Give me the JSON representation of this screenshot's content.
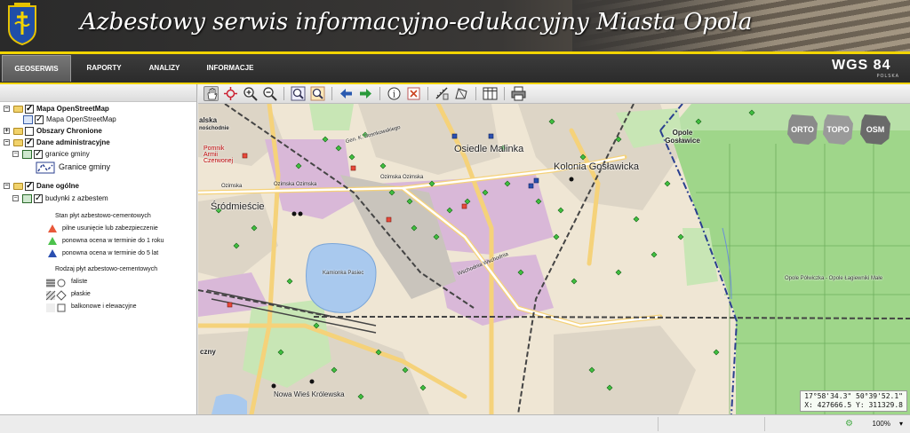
{
  "header": {
    "title": "Azbestowy serwis informacyjno-edukacyjny Miasta Opola",
    "logo_icon": "opole-coat-of-arms-icon"
  },
  "nav": {
    "tabs": [
      "GEOSERWIS",
      "RAPORTY",
      "ANALIZY",
      "INFORMACJE"
    ],
    "active_tab": "GEOSERWIS",
    "brand": "WGS 84",
    "brand_sub": "POLSKA"
  },
  "layers": {
    "groups": [
      {
        "label": "Mapa OpenStreetMap",
        "checked": true,
        "children": [
          {
            "label": "Mapa OpenStreetMap",
            "checked": true
          }
        ]
      },
      {
        "label": "Obszary Chronione",
        "checked": false,
        "children": []
      },
      {
        "label": "Dane administracyjne",
        "checked": true,
        "children": [
          {
            "label": "granice gminy",
            "checked": true,
            "legend": "Granice gminy"
          }
        ]
      },
      {
        "label": "Dane ogólne",
        "checked": true,
        "children": [
          {
            "label": "budynki z azbestem",
            "checked": true
          }
        ]
      }
    ],
    "legend": {
      "state_title": "Stan płyt azbestowo-cementowych",
      "states": [
        {
          "label": "pilne usunięcie lub zabezpieczenie",
          "color": "#e8583a"
        },
        {
          "label": "ponowna ocena w terminie do 1 roku",
          "color": "#4cc24c"
        },
        {
          "label": "ponowna ocena w terminie do 5 lat",
          "color": "#2a4fb0"
        }
      ],
      "type_title": "Rodzaj płyt azbestowo-cementowych",
      "types": [
        {
          "label": "faliste"
        },
        {
          "label": "płaskie"
        },
        {
          "label": "balkonowe i elewacyjne"
        }
      ]
    }
  },
  "toolbar": {
    "tools": [
      "pan-icon",
      "zoom-extent-icon",
      "zoom-in-icon",
      "zoom-out-icon",
      "search-icon",
      "zoom-box-icon",
      "back-arrow-icon",
      "forward-arrow-icon",
      "info-icon",
      "clear-icon",
      "measure-icon",
      "measure-area-icon",
      "table-icon",
      "print-icon"
    ]
  },
  "map": {
    "baselayers": [
      "ORTO",
      "TOPO",
      "OSM"
    ],
    "labels": {
      "malinka": "Osiedle Malinka",
      "opole_goslawice": "Opole Gosławice",
      "kolonia": "Kolonia Gosławicka",
      "srodmiescie": "Śródmieście",
      "kamionka": "Kamionka Pasiec",
      "nowa_wies": "Nowa Wieś Królewska",
      "ozimska1": "Ozimska Ozimska",
      "ozimska2": "Ozimska Ozimska",
      "ozimska3": "Ozimska",
      "wschodnia": "Wschodnia Wschodnia",
      "gen": "Gen. K. Sosnkowskiego",
      "opole_pluznica": "Opole Półwiczka  -  Opole Łagiewniki Małe",
      "pomnik": "Pomnik Armii Czerwonej",
      "malska": "alska",
      "poln": "nośchodnie",
      "czny": "czny"
    },
    "coords": {
      "dms": "17°58'34.3\" 50°39'52.1\"",
      "xy": "X: 427666.5 Y: 311329.8"
    }
  },
  "status": {
    "zoom": "100%"
  }
}
